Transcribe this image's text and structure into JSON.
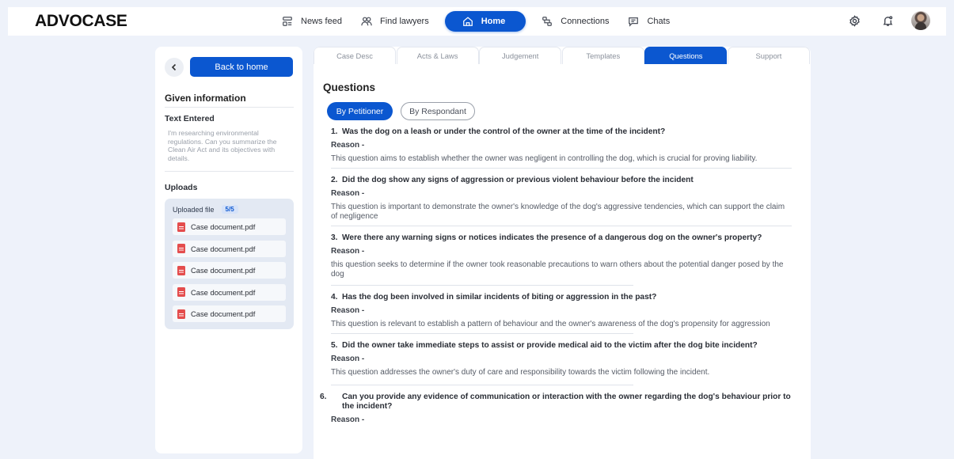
{
  "brand": {
    "logo": "ADVOCASE"
  },
  "nav": {
    "items": [
      {
        "label": "News feed",
        "icon": "news-feed-icon"
      },
      {
        "label": "Find lawyers",
        "icon": "find-lawyers-icon"
      },
      {
        "label": "Home",
        "icon": "home-icon",
        "active": true
      },
      {
        "label": "Connections",
        "icon": "connections-icon"
      },
      {
        "label": "Chats",
        "icon": "chats-icon"
      }
    ],
    "right_icons": [
      "settings-gear-icon",
      "notification-bell-icon",
      "user-avatar"
    ]
  },
  "sidebar": {
    "back_label": "Back to home",
    "given_title": "Given information",
    "text_entered_label": "Text Entered",
    "text_entered": "I'm researching environmental regulations. Can you summarize the Clean Air Act and its objectives with details.",
    "uploads_label": "Uploads",
    "uploaded_file_label": "Uploaded file",
    "uploaded_count": "5/5",
    "files": [
      "Case document.pdf",
      "Case document.pdf",
      "Case document.pdf",
      "Case document.pdf",
      "Case document.pdf"
    ]
  },
  "tabs": [
    {
      "label": "Case Desc"
    },
    {
      "label": "Acts & Laws"
    },
    {
      "label": "Judgement"
    },
    {
      "label": "Templates"
    },
    {
      "label": "Questions",
      "active": true
    },
    {
      "label": "Support"
    }
  ],
  "main": {
    "title": "Questions",
    "filter_on": "By Petitioner",
    "filter_off": "By Respondant",
    "reason_label": "Reason -",
    "questions": [
      {
        "num": "1.",
        "text": "Was the dog on a leash or under the control of the owner at the time of the incident?",
        "reason": "This question aims to establish whether the owner was negligent in controlling the dog, which is crucial for proving liability."
      },
      {
        "num": "2.",
        "text": "Did the dog show any signs of aggression or previous violent behaviour before the incident",
        "reason": "This question is important to demonstrate the owner's knowledge of the dog's aggressive tendencies, which can support the claim of negligence"
      },
      {
        "num": "3.",
        "text": "Were there any warning signs or notices indicates the presence of a dangerous dog on the owner's property?",
        "reason": "this question seeks to determine if the owner took reasonable precautions to warn others about the potential danger posed by the dog"
      },
      {
        "num": "4.",
        "text": "Has the dog been involved in similar incidents of biting or aggression in the past?",
        "reason": "This question is relevant to establish a pattern of behaviour and the owner's awareness of the dog's propensity for aggression"
      },
      {
        "num": "5.",
        "text": "Did the owner take immediate steps to assist or provide medical aid to the victim after the dog bite incident?",
        "reason": "This question addresses the owner's duty of care and responsibility towards the victim following the incident."
      },
      {
        "num": "6.",
        "text": "Can you provide any evidence of communication or interaction with the owner regarding the dog's behaviour prior to the incident?",
        "reason": ""
      }
    ]
  },
  "colors": {
    "accent": "#0b57d0",
    "background": "#eef2fa",
    "pdf": "#e44d4d"
  }
}
